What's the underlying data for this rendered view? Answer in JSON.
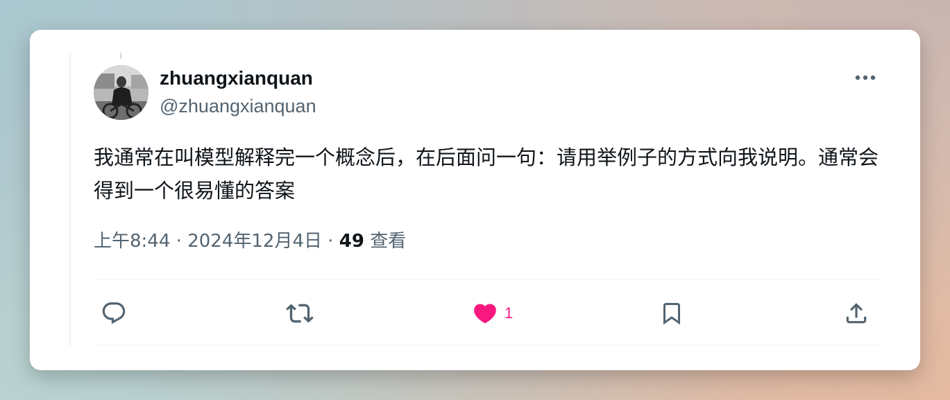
{
  "user": {
    "display_name": "zhuangxianquan",
    "handle": "@zhuangxianquan",
    "avatar_icon": "profile-photo"
  },
  "tweet": {
    "text": "我通常在叫模型解释完一个概念后，在后面问一句：请用举例子的方式向我说明。通常会得到一个很易懂的答案",
    "time": "上午8:44",
    "separator1": " · ",
    "date": "2024年12月4日",
    "separator2": " · ",
    "views_count": "49",
    "views_label": " 查看"
  },
  "actions": {
    "reply_icon": "reply-icon",
    "retweet_icon": "retweet-icon",
    "like_icon": "heart-icon",
    "like_count": "1",
    "bookmark_icon": "bookmark-icon",
    "share_icon": "share-icon"
  },
  "colors": {
    "text_primary": "#0f1419",
    "text_secondary": "#536471",
    "like": "#f91880",
    "icon": "#536471"
  }
}
